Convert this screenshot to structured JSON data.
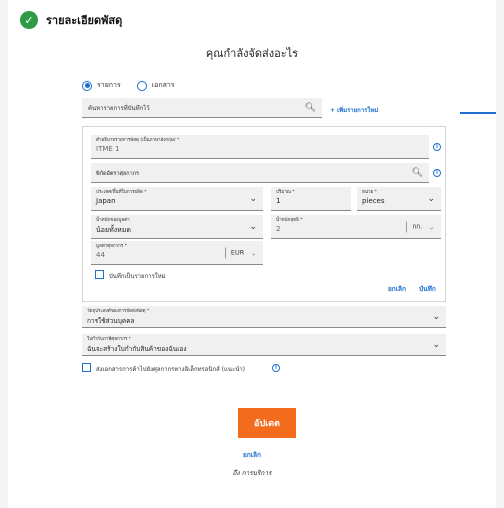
{
  "header": {
    "title": "รายละเอียดพัสดุ"
  },
  "question": "คุณกำลังจัดส่งอะไร",
  "mode": {
    "options": [
      "รายการ",
      "เอกสาร"
    ],
    "selected": "รายการ"
  },
  "search": {
    "placeholder": "ค้นหารายการที่บันทึกไว้",
    "add_label": "+ เพิ่มรายการใหม่"
  },
  "item": {
    "description": {
      "label": "คำอธิบายรายการพัสดุ (เป็นภาษาอังกฤษ) *",
      "value": "ITME 1"
    },
    "hs_code": {
      "label": "พิกัดอัตราศุลกากร"
    },
    "origin": {
      "label": "ประเทศ/พื้นที่ในการผลิต *",
      "value": "Japan"
    },
    "quantity": {
      "label": "ปริมาณ *",
      "value": "1"
    },
    "unit": {
      "label": "หน่วย *",
      "value": "pieces"
    },
    "weight_type": {
      "label": "น้ำหนักของมูลค่า",
      "value": "น้อยทั้งหมด"
    },
    "net_weight": {
      "label": "น้ำหนักสุทธิ *",
      "value": "2",
      "unit": "กก."
    },
    "customs_value": {
      "label": "มูลค่าศุลกากร *",
      "value": "44",
      "currency": "EUR"
    },
    "save_label": "บันทึกเป็นรายการใหม่",
    "cancel_label": "ยกเลิก",
    "save_btn": "บันทึก"
  },
  "purpose": {
    "label": "วัตถุประสงค์ของการจัดส่งพัสดุ *",
    "value": "การใช้ส่วนบุคคล"
  },
  "invoice": {
    "label": "ใบกำกับภาษีศุลกากร *",
    "value": "ฉันจะสร้างใบกำกับสินค้าของฉันเอง"
  },
  "paperless": {
    "label": "ส่งเอกสารการค้าไปยังศุลกากรทางอิเล็กทรอนิกส์ (แนะนำ)"
  },
  "actions": {
    "update": "อัปเดต",
    "cancel": "ยกเลิก",
    "to_service": "ถึง การบริการ"
  },
  "colors": {
    "accent": "#1f6fd1",
    "primary_btn": "#f36b1c",
    "success": "#2e9b44"
  }
}
